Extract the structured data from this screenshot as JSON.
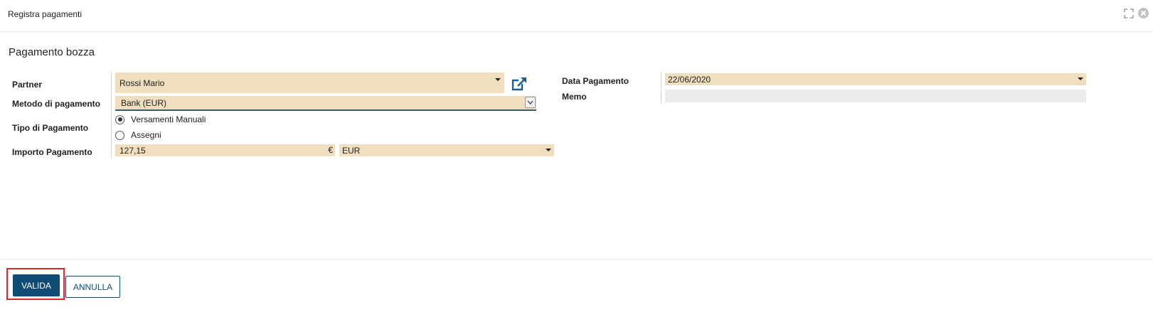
{
  "window": {
    "title": "Registra pagamenti",
    "icons": [
      "expand-icon",
      "close-icon"
    ]
  },
  "form": {
    "subtitle": "Pagamento bozza",
    "partner": {
      "label": "Partner",
      "value": "Rossi Mario"
    },
    "payment_method": {
      "label": "Metodo di pagamento",
      "value": "Bank (EUR)"
    },
    "payment_type": {
      "label": "Tipo di Pagamento",
      "options": [
        {
          "label": "Versamenti Manuali",
          "selected": true
        },
        {
          "label": "Assegni",
          "selected": false
        }
      ]
    },
    "amount": {
      "label": "Importo Pagamento",
      "value": "127,15",
      "currency_symbol": "€",
      "currency": "EUR"
    },
    "payment_date": {
      "label": "Data Pagamento",
      "value": "22/06/2020"
    },
    "memo": {
      "label": "Memo",
      "value": ""
    }
  },
  "footer": {
    "validate_label": "VALIDA",
    "cancel_label": "ANNULLA"
  },
  "colors": {
    "field_bg": "#efdfbf",
    "primary": "#0f4c75",
    "highlight": "#e0242b"
  }
}
